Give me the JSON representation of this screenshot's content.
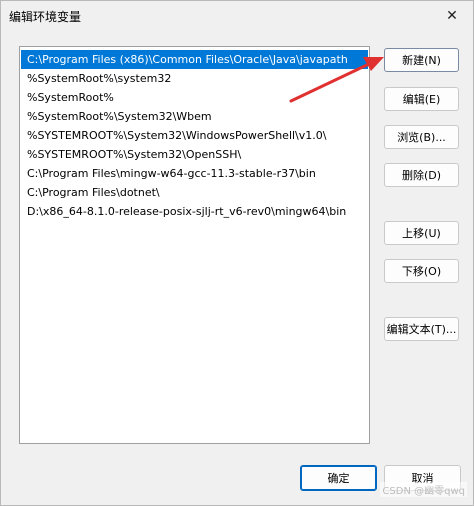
{
  "window": {
    "title": "编辑环境变量",
    "close_glyph": "✕"
  },
  "path_list": {
    "items": [
      "C:\\Program Files (x86)\\Common Files\\Oracle\\Java\\javapath",
      "%SystemRoot%\\system32",
      "%SystemRoot%",
      "%SystemRoot%\\System32\\Wbem",
      "%SYSTEMROOT%\\System32\\WindowsPowerShell\\v1.0\\",
      "%SYSTEMROOT%\\System32\\OpenSSH\\",
      "C:\\Program Files\\mingw-w64-gcc-11.3-stable-r37\\bin",
      "C:\\Program Files\\dotnet\\",
      "D:\\x86_64-8.1.0-release-posix-sjlj-rt_v6-rev0\\mingw64\\bin"
    ],
    "selected_index": 0
  },
  "buttons": {
    "new": "新建(N)",
    "edit": "编辑(E)",
    "browse": "浏览(B)...",
    "delete": "删除(D)",
    "move_up": "上移(U)",
    "move_down": "下移(O)",
    "edit_text": "编辑文本(T)...",
    "ok": "确定",
    "cancel": "取消"
  },
  "watermark": "CSDN @幽零qwq",
  "colors": {
    "selection": "#0078d7",
    "annotation_arrow": "#e03030"
  }
}
